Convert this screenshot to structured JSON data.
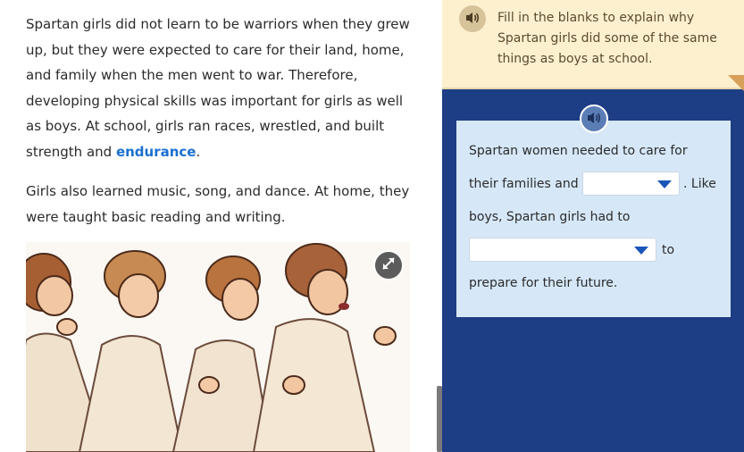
{
  "passage": {
    "paragraph1_text": "Spartan girls did not learn to be warriors when they grew up, but they were expected to care for their land, home, and family when the men went to war. Therefore, developing physical skills was important for girls as well as boys. At school, girls ran races, wrestled, and built strength and ",
    "vocab_word": "endurance",
    "paragraph1_end": ".",
    "paragraph2_text": "Girls also learned music, song, and dance. At home, they were taught basic reading and writing."
  },
  "icons": {
    "expand": "expand-arrows-icon",
    "audio": "speaker-icon",
    "dropdown": "caret-down-icon"
  },
  "activity": {
    "prompt": "Fill in the blanks to explain why Spartan girls did some of the same things as boys at school.",
    "sentence_part1": "Spartan women needed to care for",
    "sentence_part2": "their families and",
    "sentence_part3": ". Like",
    "sentence_part4": "boys, Spartan girls had to",
    "sentence_part5": "to",
    "sentence_part6": "prepare for their future.",
    "dropdown1_value": "",
    "dropdown2_value": ""
  },
  "colors": {
    "vocab": "#1a6fd1",
    "prompt_bg": "#fdf0cf",
    "card_bg": "#d6e8f8",
    "panel_bg": "#1d3e85",
    "caret": "#1a56b8"
  }
}
